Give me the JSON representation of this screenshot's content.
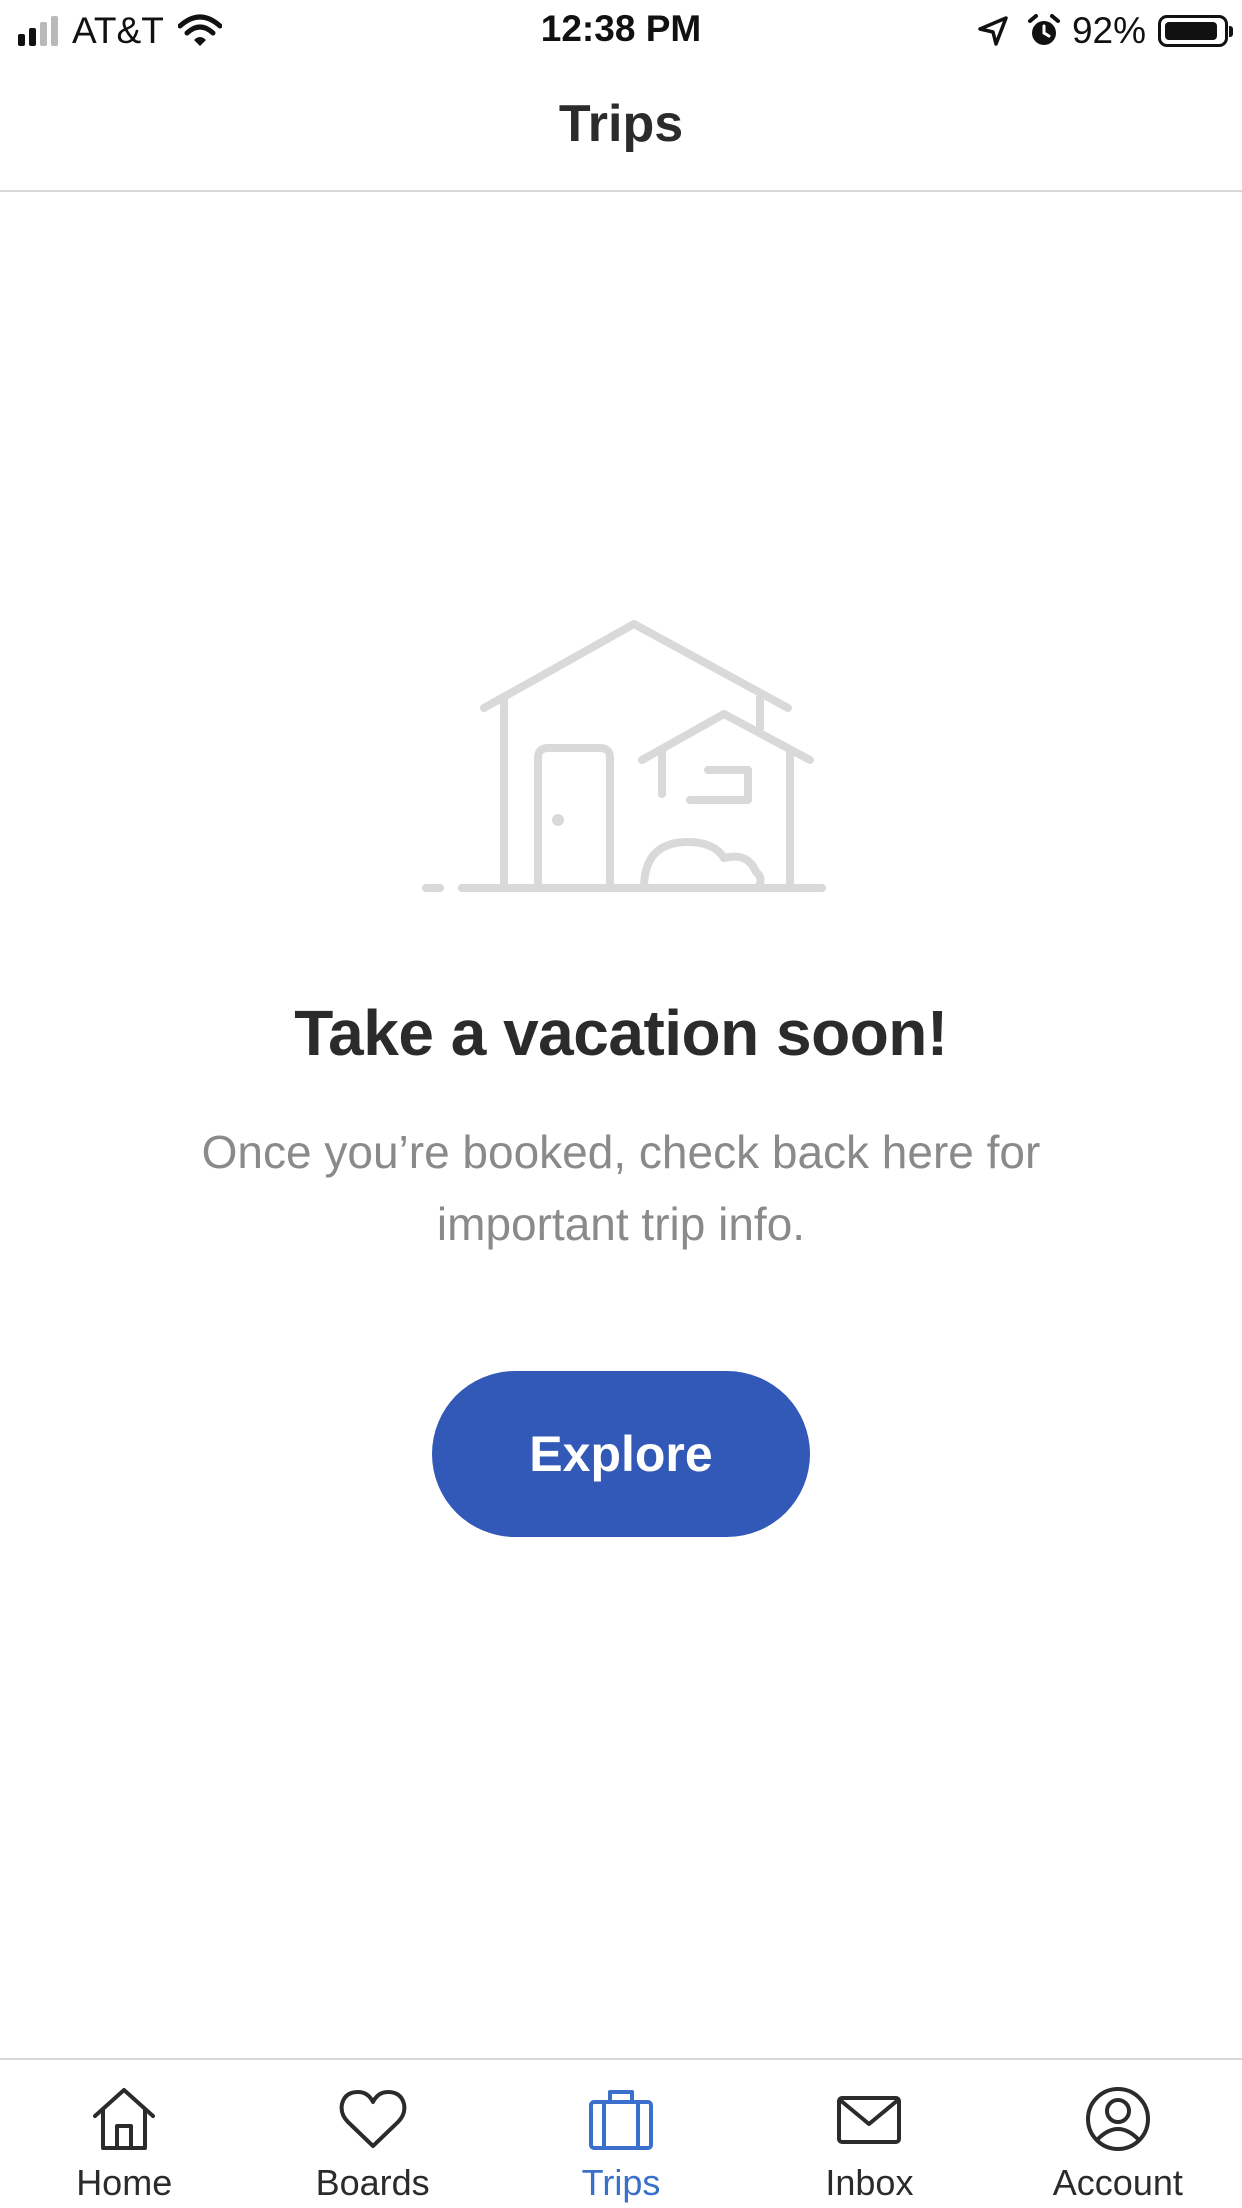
{
  "status_bar": {
    "carrier": "AT&T",
    "time": "12:38 PM",
    "battery_percent": "92%",
    "icons": [
      "signal-icon",
      "wifi-icon",
      "location-icon",
      "alarm-icon",
      "battery-icon"
    ]
  },
  "nav": {
    "title": "Trips"
  },
  "empty_state": {
    "illustration": "house-icon",
    "title": "Take a vacation soon!",
    "description": "Once you’re booked, check back here for important trip info.",
    "button_label": "Explore"
  },
  "tab_bar": {
    "active_tab": "Trips",
    "active_color": "#3a6fcc",
    "tabs": [
      {
        "label": "Home",
        "icon": "home-icon"
      },
      {
        "label": "Boards",
        "icon": "heart-icon"
      },
      {
        "label": "Trips",
        "icon": "suitcase-icon"
      },
      {
        "label": "Inbox",
        "icon": "envelope-icon"
      },
      {
        "label": "Account",
        "icon": "account-icon"
      }
    ]
  },
  "colors": {
    "accent": "#3259b8",
    "text": "#2b2b2b",
    "muted_text": "#8a8a8a",
    "illustration": "#d9d9d9"
  }
}
